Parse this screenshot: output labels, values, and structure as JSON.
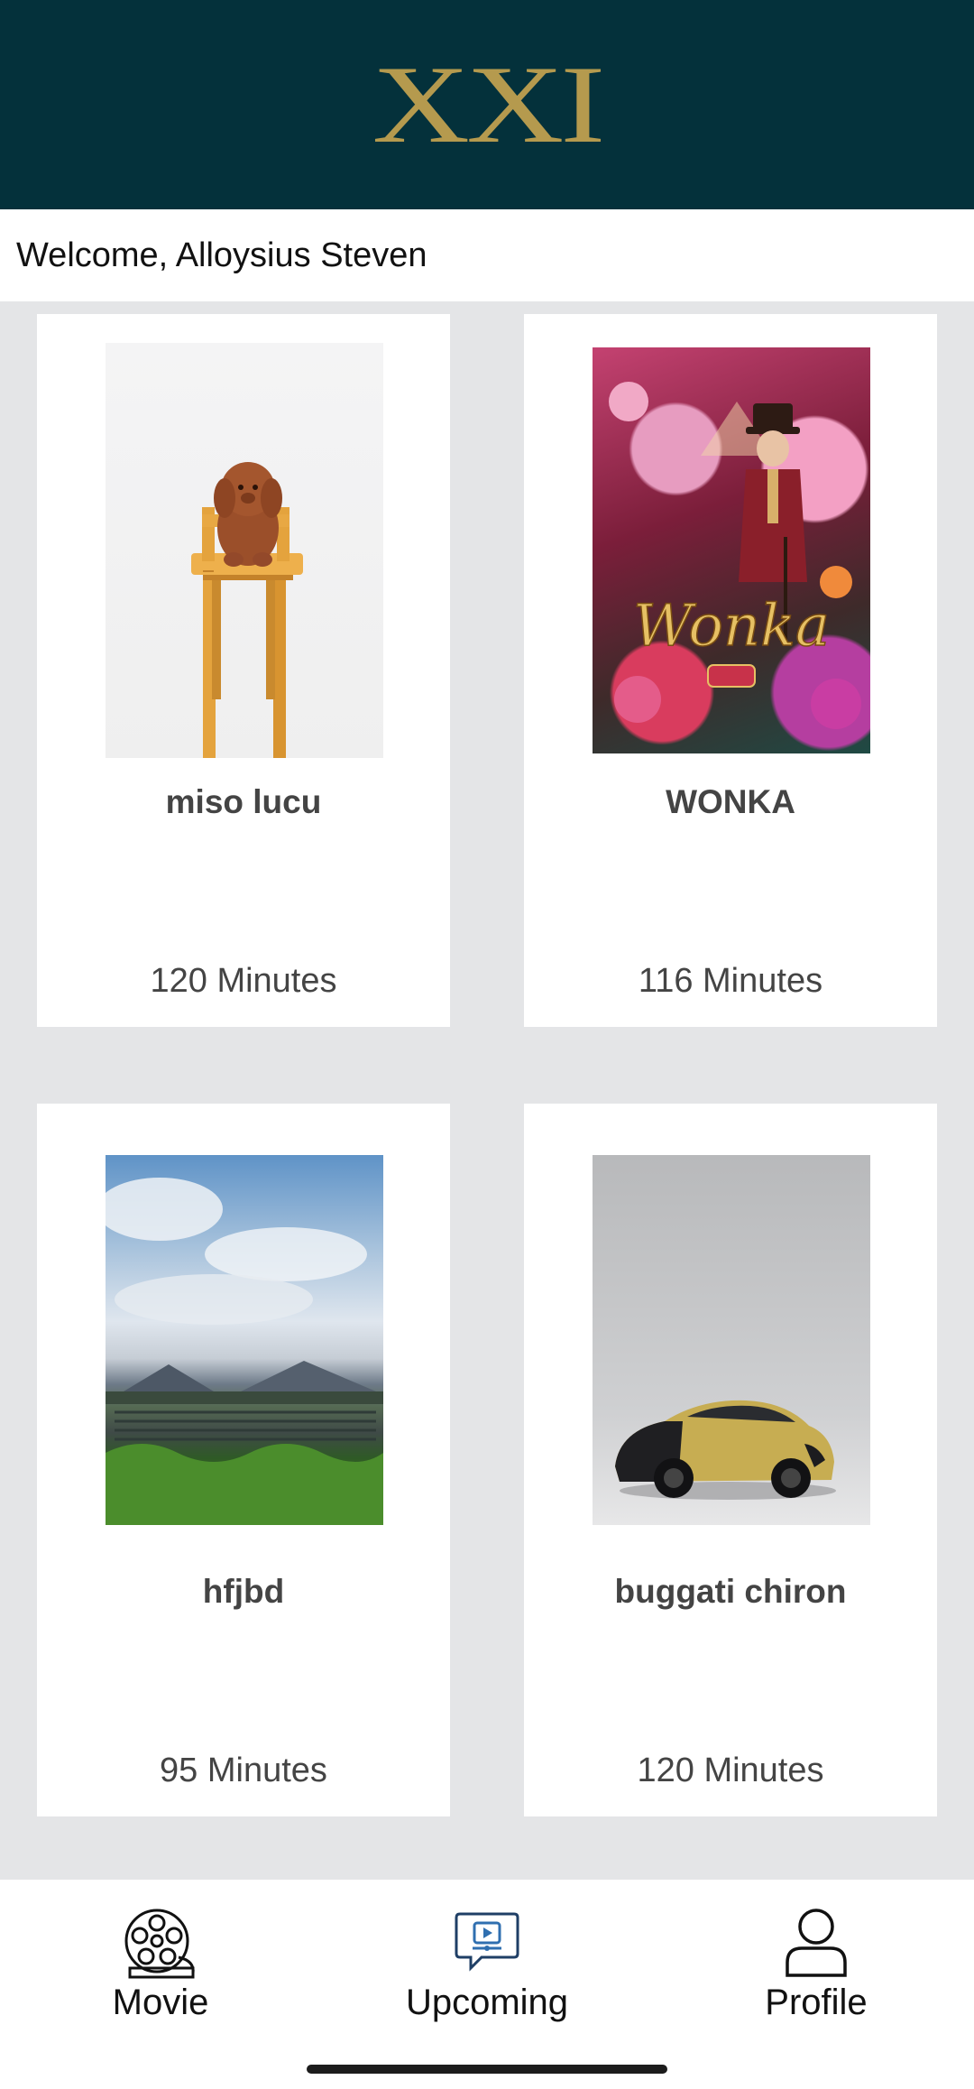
{
  "app": {
    "logo": "XXI",
    "welcome": "Welcome, Alloysius Steven"
  },
  "movies": [
    {
      "title": "miso lucu",
      "duration": "120 Minutes"
    },
    {
      "title": "WONKA",
      "duration": "116 Minutes"
    },
    {
      "title": "hfjbd",
      "duration": "95 Minutes"
    },
    {
      "title": "buggati chiron",
      "duration": "120 Minutes"
    }
  ],
  "nav": {
    "movie": "Movie",
    "upcoming": "Upcoming",
    "profile": "Profile"
  },
  "colors": {
    "header": "#04313b",
    "logo_gold": "#b59a4e",
    "background": "#e4e5e7",
    "upcoming_icon": "#2f6fb0"
  },
  "icons": [
    "film-reel-icon",
    "upcoming-screen-icon",
    "profile-icon"
  ]
}
